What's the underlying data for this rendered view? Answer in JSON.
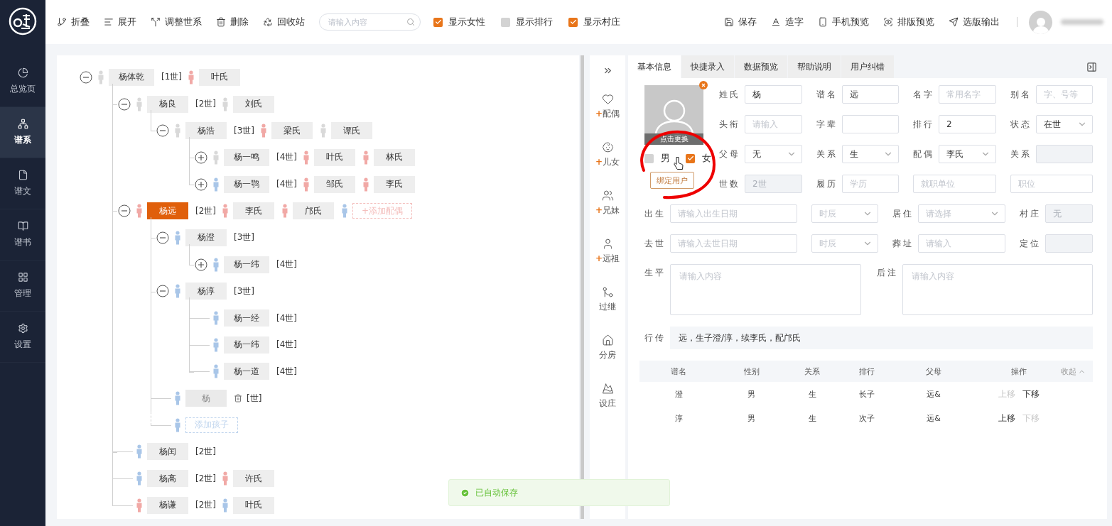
{
  "sidebar": {
    "items": [
      {
        "label": "总览页",
        "selected": false
      },
      {
        "label": "谱系",
        "selected": true
      },
      {
        "label": "谱文",
        "selected": false
      },
      {
        "label": "谱书",
        "selected": false
      },
      {
        "label": "管理",
        "selected": false
      },
      {
        "label": "设置",
        "selected": false
      }
    ]
  },
  "toolbar": {
    "actions": [
      {
        "label": "折叠"
      },
      {
        "label": "展开"
      },
      {
        "label": "调整世系"
      },
      {
        "label": "删除"
      },
      {
        "label": "回收站"
      }
    ],
    "search": {
      "placeholder": "请输入内容"
    },
    "toggles": [
      {
        "label": "显示女性",
        "checked": true
      },
      {
        "label": "显示排行",
        "checked": false
      },
      {
        "label": "显示村庄",
        "checked": true
      }
    ],
    "right_actions": [
      {
        "label": "保存"
      },
      {
        "label": "造字"
      },
      {
        "label": "手机预览"
      },
      {
        "label": "排版预览"
      },
      {
        "label": "选版输出"
      }
    ]
  },
  "tree": {
    "kind": "person",
    "name": "杨体乾",
    "generation": "[1世]",
    "color": "#d9d9d9",
    "expanded": true,
    "selected": false,
    "spouses": [
      {
        "name": "叶氏",
        "color": "#f1a9a6"
      }
    ],
    "children": [
      {
        "kind": "person",
        "name": "杨良",
        "generation": "[2世]",
        "color": "#d9d9d9",
        "expanded": true,
        "selected": false,
        "spouses": [
          {
            "name": "刘氏",
            "color": "#d9d9d9"
          }
        ],
        "children": [
          {
            "kind": "person",
            "name": "杨浩",
            "generation": "[3世]",
            "color": "#d9d9d9",
            "expanded": true,
            "selected": false,
            "spouses": [
              {
                "name": "梁氏",
                "color": "#f1a9a6"
              },
              {
                "name": "谭氏",
                "color": "#d9d9d9"
              }
            ],
            "children": [
              {
                "kind": "person",
                "name": "杨一鸣",
                "generation": "[4世]",
                "color": "#d9d9d9",
                "expanded": false,
                "selected": false,
                "spouses": [
                  {
                    "name": "叶氏",
                    "color": "#f1a9a6"
                  },
                  {
                    "name": "林氏",
                    "color": "#f1a9a6"
                  }
                ]
              },
              {
                "kind": "person",
                "name": "杨一鹗",
                "generation": "[4世]",
                "color": "#a9c6e8",
                "expanded": false,
                "selected": false,
                "spouses": [
                  {
                    "name": "邹氏",
                    "color": "#f1a9a6"
                  },
                  {
                    "name": "李氏",
                    "color": "#f1a9a6"
                  }
                ]
              }
            ]
          }
        ]
      },
      {
        "kind": "person",
        "name": "杨远",
        "generation": "[2世]",
        "color": "#f1a9a6",
        "expanded": true,
        "selected": true,
        "spouses": [
          {
            "name": "李氏",
            "color": "#f1a9a6"
          },
          {
            "name": "邝氏",
            "color": "#f1a9a6"
          }
        ],
        "add_spouse": {
          "label": "+添加配偶",
          "color": "#a9c6e8"
        },
        "children": [
          {
            "kind": "person",
            "name": "杨澄",
            "generation": "[3世]",
            "color": "#a9c6e8",
            "expanded": true,
            "selected": false,
            "children": [
              {
                "kind": "person",
                "name": "杨一纬",
                "generation": "[4世]",
                "color": "#a9c6e8",
                "expanded": false,
                "selected": false
              }
            ]
          },
          {
            "kind": "person",
            "name": "杨淳",
            "generation": "[3世]",
            "color": "#a9c6e8",
            "expanded": true,
            "selected": false,
            "children": [
              {
                "kind": "person",
                "name": "杨一经",
                "generation": "[4世]",
                "color": "#a9c6e8",
                "selected": false
              },
              {
                "kind": "person",
                "name": "杨一纬",
                "generation": "[4世]",
                "color": "#a9c6e8",
                "selected": false
              },
              {
                "kind": "person",
                "name": "杨一道",
                "generation": "[4世]",
                "color": "#a9c6e8",
                "selected": false
              }
            ]
          },
          {
            "kind": "draft",
            "name": "杨",
            "generation": "[世]",
            "color": "#a9c6e8"
          },
          {
            "kind": "add",
            "label": "添加孩子",
            "color": "#a9c6e8"
          }
        ]
      },
      {
        "kind": "person",
        "name": "杨闰",
        "generation": "[2世]",
        "color": "#a9c6e8",
        "selected": false
      },
      {
        "kind": "person",
        "name": "杨高",
        "generation": "[2世]",
        "color": "#a9c6e8",
        "selected": false,
        "spouses": [
          {
            "name": "许氏",
            "color": "#f1a9a6"
          }
        ]
      },
      {
        "kind": "person",
        "name": "杨谦",
        "generation": "[2世]",
        "color": "#f1a9a6",
        "selected": false,
        "spouses": [
          {
            "name": "叶氏",
            "color": "#a9c6e8"
          }
        ]
      }
    ]
  },
  "side_actions": [
    {
      "prefix": "+",
      "label": "配偶"
    },
    {
      "prefix": "+",
      "label": "儿女"
    },
    {
      "prefix": "+",
      "label": "兄妹"
    },
    {
      "prefix": "+",
      "label": "远祖"
    },
    {
      "label": "过继"
    },
    {
      "label": "分房"
    },
    {
      "label": "设庄"
    }
  ],
  "tabs": [
    {
      "label": "基本信息",
      "selected": true
    },
    {
      "label": "快捷录入",
      "selected": false
    },
    {
      "label": "数据预览",
      "selected": false
    },
    {
      "label": "帮助说明",
      "selected": false
    },
    {
      "label": "用户纠错",
      "selected": false
    }
  ],
  "profile": {
    "photo_caption": "点击更换",
    "genders": [
      {
        "label": "男",
        "checked": false
      },
      {
        "label": "女",
        "checked": true
      }
    ],
    "bind_button": "绑定用户"
  },
  "fields_top": [
    [
      {
        "label": "姓氏",
        "kind": "text",
        "value": "杨"
      },
      {
        "label": "谱名",
        "kind": "text",
        "value": "远"
      },
      {
        "label": "名字",
        "kind": "text",
        "placeholder": "常用名字"
      },
      {
        "label": "别名",
        "kind": "text",
        "placeholder": "字、号等"
      }
    ],
    [
      {
        "label": "头衔",
        "kind": "text",
        "placeholder": "请输入"
      },
      {
        "label": "字辈",
        "kind": "text"
      },
      {
        "label": "排行",
        "kind": "text",
        "value": "2"
      },
      {
        "label": "状态",
        "kind": "select",
        "value": "在世"
      }
    ],
    [
      {
        "label": "父母",
        "kind": "select",
        "value": "无"
      },
      {
        "label": "关系",
        "kind": "select",
        "value": "生"
      },
      {
        "label": "配偶",
        "kind": "select",
        "value": "李氏"
      },
      {
        "label": "关系",
        "kind": "disabled"
      }
    ],
    [
      {
        "label": "世数",
        "kind": "disabled",
        "value": "2世"
      },
      {
        "label": "履历",
        "kind": "text",
        "placeholder": "学历"
      },
      {
        "kind": "text",
        "placeholder": "就职单位"
      },
      {
        "kind": "text",
        "placeholder": "职位"
      }
    ]
  ],
  "fields_bottom": [
    [
      {
        "label": "出生",
        "kind": "date",
        "placeholder": "请输入出生日期"
      },
      {
        "kind": "select",
        "placeholder": "时辰"
      },
      {
        "label": "居住",
        "kind": "select",
        "placeholder": "请选择"
      },
      {
        "label": "村庄",
        "kind": "disabled",
        "value": "无"
      }
    ],
    [
      {
        "label": "去世",
        "kind": "date",
        "placeholder": "请输入去世日期"
      },
      {
        "kind": "select",
        "placeholder": "时辰"
      },
      {
        "label": "葬址",
        "kind": "text",
        "placeholder": "请输入"
      },
      {
        "label": "定位",
        "kind": "disabled"
      }
    ]
  ],
  "notes": [
    {
      "label": "生平",
      "placeholder": "请输入内容"
    },
    {
      "label": "后注",
      "placeholder": "请输入内容"
    }
  ],
  "biography": {
    "label": "行传",
    "value": "远，生子澄/淳，续李氏，配邝氏"
  },
  "children_table": {
    "columns": [
      "谱名",
      "性别",
      "关系",
      "排行",
      "父母",
      "操作"
    ],
    "collapse": "收起",
    "rows": [
      {
        "cells": [
          "澄",
          "男",
          "生",
          "长子",
          "远&"
        ],
        "actions": [
          {
            "label": "上移",
            "disabled": true
          },
          {
            "label": "下移",
            "disabled": false
          }
        ]
      },
      {
        "cells": [
          "淳",
          "男",
          "生",
          "次子",
          "远&"
        ],
        "actions": [
          {
            "label": "上移",
            "disabled": false
          },
          {
            "label": "下移",
            "disabled": true
          }
        ]
      }
    ]
  },
  "toast": {
    "text": "已自动保存"
  }
}
